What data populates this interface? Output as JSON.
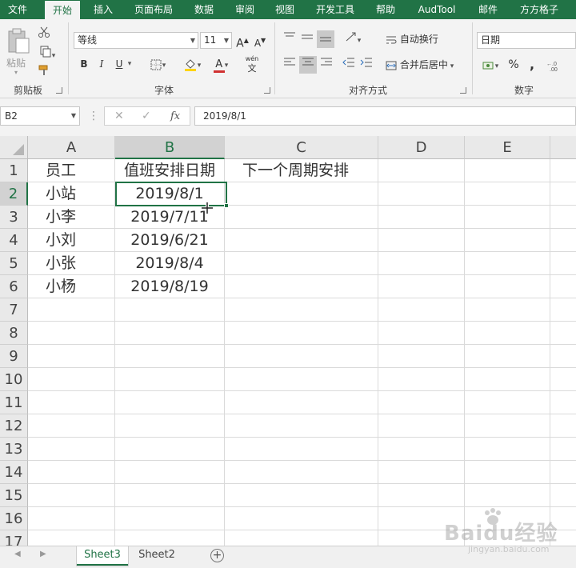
{
  "ribbon_tabs": [
    "文件",
    "开始",
    "插入",
    "页面布局",
    "数据",
    "审阅",
    "视图",
    "开发工具",
    "帮助",
    "AudTool",
    "邮件",
    "方方格子"
  ],
  "active_tab": "开始",
  "clipboard": {
    "paste_label": "粘贴",
    "group_label": "剪贴板"
  },
  "font": {
    "name": "等线",
    "size": "11",
    "bold": "B",
    "italic": "I",
    "underline": "U",
    "wen": "wén",
    "wen_char": "文",
    "font_color_letter": "A",
    "grow": "A",
    "shrink": "A",
    "group_label": "字体"
  },
  "alignment": {
    "wrap_text": "自动换行",
    "merge_center": "合并后居中",
    "group_label": "对齐方式"
  },
  "number": {
    "format": "日期",
    "percent": "%",
    "comma": ",",
    "group_label": "数字"
  },
  "formula_bar": {
    "name_box": "B2",
    "fx": "fx",
    "content": "2019/8/1"
  },
  "columns": [
    "A",
    "B",
    "C",
    "D",
    "E"
  ],
  "rows": [
    "1",
    "2",
    "3",
    "4",
    "5",
    "6",
    "7",
    "8",
    "9",
    "10",
    "11",
    "12",
    "13",
    "14",
    "15",
    "16",
    "17"
  ],
  "cells": {
    "A1": "员工",
    "B1": "值班安排日期",
    "C1": "下一个周期安排",
    "A2": "小站",
    "B2": "2019/8/1",
    "A3": "小李",
    "B3": "2019/7/11",
    "A4": "小刘",
    "B4": "2019/6/21",
    "A5": "小张",
    "B5": "2019/8/4",
    "A6": "小杨",
    "B6": "2019/8/19"
  },
  "active_cell": "B2",
  "sheet_tabs": [
    "Sheet3",
    "Sheet2"
  ],
  "active_sheet": "Sheet3",
  "watermark": {
    "text": "Baidu经验",
    "url": "jingyan.baidu.com"
  },
  "colors": {
    "excel_green": "#217346",
    "font_color_bar": "#d03030",
    "fill_color_bar": "#ffd400"
  }
}
